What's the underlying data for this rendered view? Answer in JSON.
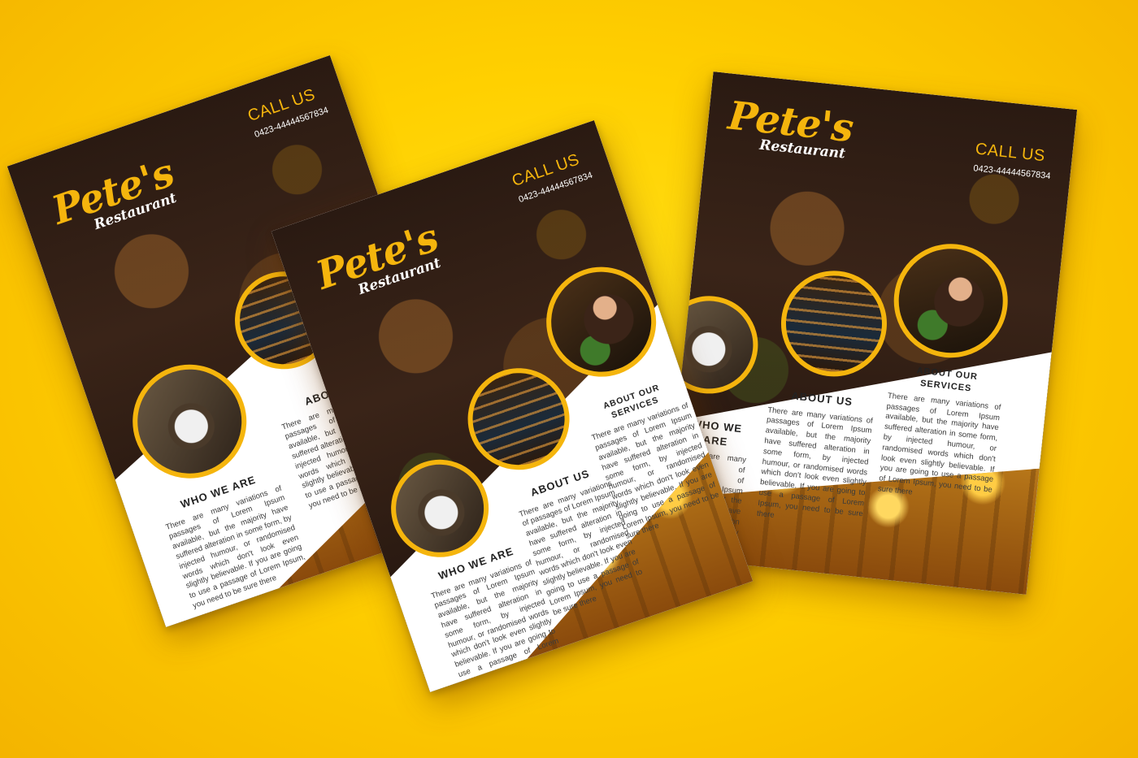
{
  "colors": {
    "background": "#ffd000",
    "accent": "#f5b50d",
    "dark": "#2a1a12"
  },
  "flyers": [
    {
      "id": "left",
      "logo_main": "Pete's",
      "logo_sub": "Restaurant",
      "call_title": "CALL US",
      "phone": "0423-44444567834",
      "who_title": "WHO WE ARE",
      "who_body": "There are many variations of passages of Lorem Ipsum available, but the majority have suffered alteration in some form, by injected humour, or randomised words which don't look even slightly believable. If you are going to use a passage of Lorem Ipsum, you need to be sure there",
      "about_title": "ABOUT US",
      "about_body": "There are many variations of passages of Lorem Ipsum available, but the majority have suffered alteration in some form, by injected humour, or randomised words which don't look even slightly believable. If you are going to use a passage of Lorem Ipsum, you need to be sure there"
    },
    {
      "id": "center",
      "logo_main": "Pete's",
      "logo_sub": "Restaurant",
      "call_title": "CALL US",
      "phone": "0423-44444567834",
      "who_title": "WHO WE ARE",
      "who_body": "There are many variations of passages of Lorem Ipsum available, but the majority have suffered alteration in some form, by injected humour, or randomised words which don't look even slightly believable. If you are going to use a passage of Lorem Ipsum, you need to be sure there",
      "about_title": "ABOUT US",
      "about_body": "There are many variations of passages of Lorem Ipsum available, but the majority have suffered alteration in some form, by injected humour, or randomised words which don't look even slightly believable. If you are going to use a passage of Lorem Ipsum, you need to be sure there",
      "services_title": "ABOUT OUR SERVICES",
      "services_body": "There are many variations of passages of Lorem Ipsum available, but the majority have suffered alteration in some form, by injected humour, or randomised words which don't look even slightly believable. If you are going to use a passage of Lorem Ipsum, you need to be sure there"
    },
    {
      "id": "right",
      "logo_main": "Pete's",
      "logo_sub": "Restaurant",
      "call_title": "CALL US",
      "phone": "0423-44444567834",
      "who_title": "WHO WE ARE",
      "who_body": "There are many variations of passages of Lorem Ipsum available, but the majority have suffered alteration in some form, by injected humour, or randomised words which don't look even slightly believable. If you are going to use a passage of Lorem Ipsum, you need to be sure there",
      "about_title": "ABOUT US",
      "about_body": "There are many variations of passages of Lorem Ipsum available, but the majority have suffered alteration in some form, by injected humour, or randomised words which don't look even slightly believable. If you are going to use a passage of Lorem Ipsum, you need to be sure there",
      "services_title": "ABOUT OUR SERVICES",
      "services_body": "There are many variations of passages of Lorem Ipsum available, but the majority have suffered alteration in some form, by injected humour, or randomised words which don't look even slightly believable. If you are going to use a passage of Lorem Ipsum, you need to be sure there"
    }
  ]
}
